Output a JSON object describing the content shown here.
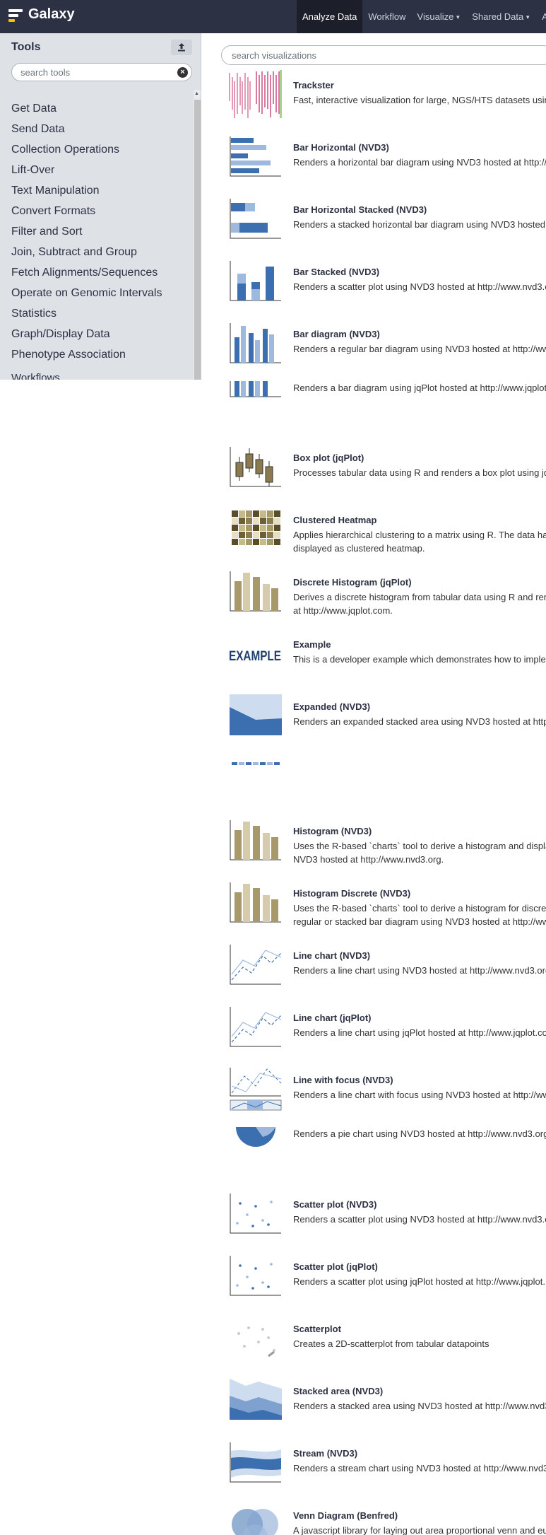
{
  "masthead": {
    "brand": "Galaxy",
    "nav": [
      {
        "label": "Analyze Data",
        "active": true
      },
      {
        "label": "Workflow"
      },
      {
        "label": "Visualize",
        "dropdown": true
      },
      {
        "label": "Shared Data",
        "dropdown": true
      },
      {
        "label": "Ad"
      }
    ]
  },
  "toolpanel": {
    "title": "Tools",
    "search_placeholder": "search tools",
    "sections": [
      "Get Data",
      "Send Data",
      "Collection Operations",
      "Lift-Over",
      "Text Manipulation",
      "Convert Formats",
      "Filter and Sort",
      "Join, Subtract and Group",
      "Fetch Alignments/Sequences",
      "Operate on Genomic Intervals",
      "Statistics",
      "Graph/Display Data",
      "Phenotype Association"
    ],
    "workflows_label": "Workflows"
  },
  "center": {
    "search_placeholder": "search visualizations",
    "visualizations": [
      {
        "name": "Trackster",
        "desc": "Fast, interactive visualization for large, NGS/HTS datasets using",
        "thumb": "trackster"
      },
      {
        "name": "Bar Horizontal (NVD3)",
        "desc": "Renders a horizontal bar diagram using NVD3 hosted at http://",
        "thumb": "barh"
      },
      {
        "name": "Bar Horizontal Stacked (NVD3)",
        "desc": "Renders a stacked horizontal bar diagram using NVD3 hosted a",
        "thumb": "barhstack"
      },
      {
        "name": "Bar Stacked (NVD3)",
        "desc": "Renders a scatter plot using NVD3 hosted at http://www.nvd3.o",
        "thumb": "barstack"
      },
      {
        "name": "Bar diagram (NVD3)",
        "desc": "Renders a regular bar diagram using NVD3 hosted at http://ww",
        "thumb": "bar"
      },
      {
        "name": "",
        "desc": "Renders a bar diagram using jqPlot hosted at http://www.jqplot",
        "thumb": "barcut"
      },
      {
        "name": "Box plot (jqPlot)",
        "desc": "Processes tabular data using R and renders a box plot using jqP",
        "thumb": "box"
      },
      {
        "name": "Clustered Heatmap",
        "desc": "Applies hierarchical clustering to a matrix using R. The data has is displayed as clustered heatmap.",
        "thumb": "heatmap"
      },
      {
        "name": "Discrete Histogram (jqPlot)",
        "desc": "Derives a discrete histogram from tabular data using R and rend at http://www.jqplot.com.",
        "thumb": "hist"
      },
      {
        "name": "Example",
        "desc": "This is a developer example which demonstrates how to implem charts.",
        "thumb": "example",
        "thumb_text": "EXAMPLE"
      },
      {
        "name": "Expanded (NVD3)",
        "desc": "Renders an expanded stacked area using NVD3 hosted at http:/",
        "thumb": "expanded"
      },
      {
        "name": "",
        "desc": "",
        "thumb": "dashes"
      },
      {
        "name": "Histogram (NVD3)",
        "desc": "Uses the R-based `charts` tool to derive a histogram and display NVD3 hosted at http://www.nvd3.org.",
        "thumb": "hist"
      },
      {
        "name": "Histogram Discrete (NVD3)",
        "desc": "Uses the R-based `charts` tool to derive a histogram for discrete regular or stacked bar diagram using NVD3 hosted at http://www",
        "thumb": "hist"
      },
      {
        "name": "Line chart (NVD3)",
        "desc": "Renders a line chart using NVD3 hosted at http://www.nvd3.org",
        "thumb": "line"
      },
      {
        "name": "Line chart (jqPlot)",
        "desc": "Renders a line chart using jqPlot hosted at http://www.jqplot.co",
        "thumb": "line"
      },
      {
        "name": "Line with focus (NVD3)",
        "desc": "Renders a line chart with focus using NVD3 hosted at http://ww",
        "thumb": "linefocus"
      },
      {
        "name": "",
        "desc": "Renders a pie chart using NVD3 hosted at http://www.nvd3.org.",
        "thumb": "piecut"
      },
      {
        "name": "Scatter plot (NVD3)",
        "desc": "Renders a scatter plot using NVD3 hosted at http://www.nvd3.o",
        "thumb": "scatter"
      },
      {
        "name": "Scatter plot (jqPlot)",
        "desc": "Renders a scatter plot using jqPlot hosted at http://www.jqplot.",
        "thumb": "scatter"
      },
      {
        "name": "Scatterplot",
        "desc": "Creates a 2D-scatterplot from tabular datapoints",
        "thumb": "scatterplot"
      },
      {
        "name": "Stacked area (NVD3)",
        "desc": "Renders a stacked area using NVD3 hosted at http://www.nvd3.",
        "thumb": "stacked"
      },
      {
        "name": "Stream (NVD3)",
        "desc": "Renders a stream chart using NVD3 hosted at http://www.nvd3.",
        "thumb": "stream"
      },
      {
        "name": "Venn Diagram (Benfred)",
        "desc": "A javascript library for laying out area proportional venn and eu",
        "thumb": "venn"
      }
    ]
  }
}
